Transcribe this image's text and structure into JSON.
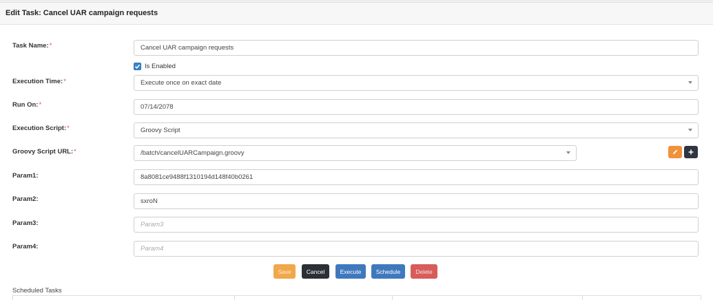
{
  "header": {
    "title": "Edit Task: Cancel UAR campaign requests"
  },
  "required_marker": "*",
  "form": {
    "task_name": {
      "label": "Task Name:",
      "value": "Cancel UAR campaign requests"
    },
    "is_enabled": {
      "label": "Is Enabled",
      "checked": true
    },
    "execution_time": {
      "label": "Execution Time:",
      "value": "Execute once on exact date"
    },
    "run_on": {
      "label": "Run On:",
      "value": "07/14/2078"
    },
    "execution_script": {
      "label": "Execution Script:",
      "value": "Groovy Script"
    },
    "groovy_script_url": {
      "label": "Groovy Script URL:",
      "value": "/batch/cancelUARCampaign.groovy"
    },
    "param1": {
      "label": "Param1:",
      "value": "8a8081ce9488f1310194d148f40b0261"
    },
    "param2": {
      "label": "Param2:",
      "value": "sxroN"
    },
    "param3": {
      "label": "Param3:",
      "value": "",
      "placeholder": "Param3"
    },
    "param4": {
      "label": "Param4:",
      "value": "",
      "placeholder": "Param4"
    }
  },
  "buttons": {
    "save": "Save",
    "cancel": "Cancel",
    "execute": "Execute",
    "schedule": "Schedule",
    "delete": "Delete"
  },
  "icons": {
    "edit": "pencil-icon",
    "add": "plus-icon"
  },
  "colors": {
    "save": "#f0a84a",
    "cancel": "#2b2f36",
    "execute": "#3f79bd",
    "schedule": "#3f79bd",
    "delete": "#d75c5a",
    "edit_icon_button": "#f0923b",
    "add_icon_button": "#2f3640",
    "checkbox": "#3a86c8",
    "required": "#d9534f"
  },
  "scheduled_tasks": {
    "title": "Scheduled Tasks"
  }
}
